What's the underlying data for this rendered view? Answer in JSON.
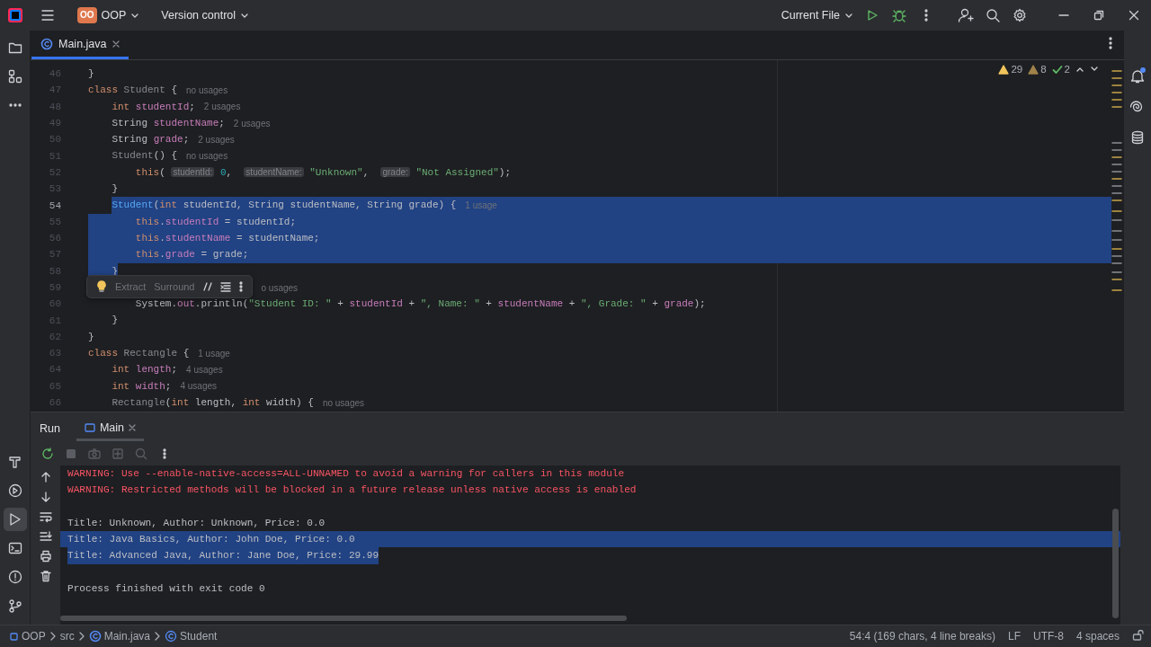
{
  "title_bar": {
    "project_badge": "OO",
    "project": "OOP",
    "vcs": "Version control",
    "run_config": "Current File"
  },
  "left_tools": [
    {
      "kind": "project",
      "selected": false
    },
    {
      "kind": "structure",
      "selected": false
    },
    {
      "kind": "more",
      "selected": false
    }
  ],
  "left_tools_bottom": [
    {
      "kind": "build",
      "selected": false
    },
    {
      "kind": "services",
      "selected": false
    },
    {
      "kind": "run",
      "selected": true
    },
    {
      "kind": "terminal",
      "selected": false
    },
    {
      "kind": "problems",
      "selected": false
    },
    {
      "kind": "git",
      "selected": false
    }
  ],
  "right_tools": [
    {
      "kind": "notifications",
      "unread": true
    },
    {
      "kind": "assistant",
      "unread": false
    },
    {
      "kind": "database",
      "unread": false
    }
  ],
  "editor_tabs": [
    {
      "label": "Main.java",
      "selected": true
    }
  ],
  "inspections": {
    "warnings": "29",
    "weak_warnings": "8",
    "typos": "2"
  },
  "lines": [
    {
      "number": "46",
      "current": false,
      "selected": false,
      "tokens": [
        {
          "t": "}",
          "kind": "plain"
        }
      ]
    },
    {
      "number": "47",
      "current": false,
      "selected": false,
      "tokens": [
        {
          "t": "class",
          "kind": "kw"
        },
        {
          "t": " Student",
          "kind": "unused"
        },
        {
          "t": " {",
          "kind": "plain"
        }
      ],
      "usage": "no usages"
    },
    {
      "number": "48",
      "current": false,
      "selected": false,
      "tokens": [
        {
          "t": "    int",
          "kind": "kw"
        },
        {
          "t": " studentId",
          "kind": "field"
        },
        {
          "t": ";",
          "kind": "plain"
        }
      ],
      "usage": "2 usages"
    },
    {
      "number": "49",
      "current": false,
      "selected": false,
      "tokens": [
        {
          "t": "    String ",
          "kind": "plain"
        },
        {
          "t": "studentName",
          "kind": "field"
        },
        {
          "t": ";",
          "kind": "plain"
        }
      ],
      "usage": "2 usages"
    },
    {
      "number": "50",
      "current": false,
      "selected": false,
      "tokens": [
        {
          "t": "    String ",
          "kind": "plain"
        },
        {
          "t": "grade",
          "kind": "field"
        },
        {
          "t": ";",
          "kind": "plain"
        }
      ],
      "usage": "2 usages"
    },
    {
      "number": "51",
      "current": false,
      "selected": false,
      "tokens": [
        {
          "t": "    Student",
          "kind": "unused"
        },
        {
          "t": "() {",
          "kind": "plain"
        }
      ],
      "usage": "no usages"
    },
    {
      "number": "52",
      "current": false,
      "selected": false,
      "tokens": [
        {
          "t": "        this",
          "kind": "kw"
        },
        {
          "t": "( ",
          "kind": "plain"
        },
        {
          "t": "studentId:",
          "kind": "inlay"
        },
        {
          "t": " 0",
          "kind": "num"
        },
        {
          "t": ",  ",
          "kind": "plain"
        },
        {
          "t": "studentName:",
          "kind": "inlay"
        },
        {
          "t": " \"Unknown\"",
          "kind": "str"
        },
        {
          "t": ",  ",
          "kind": "plain"
        },
        {
          "t": "grade:",
          "kind": "inlay"
        },
        {
          "t": " \"Not Assigned\"",
          "kind": "str"
        },
        {
          "t": ");",
          "kind": "plain"
        }
      ]
    },
    {
      "number": "53",
      "current": false,
      "selected": false,
      "tokens": [
        {
          "t": "    }",
          "kind": "plain"
        }
      ]
    },
    {
      "number": "54",
      "current": true,
      "selected": true,
      "tokens": [
        {
          "t": "    Student",
          "kind": "method"
        },
        {
          "t": "(",
          "kind": "plain"
        },
        {
          "t": "int",
          "kind": "kw"
        },
        {
          "t": " studentId, String studentName, String grade) {",
          "kind": "plain"
        }
      ],
      "usage": "1 usage"
    },
    {
      "number": "55",
      "current": false,
      "selected": true,
      "tokens": [
        {
          "t": "        this",
          "kind": "kw"
        },
        {
          "t": ".",
          "kind": "plain"
        },
        {
          "t": "studentId",
          "kind": "field"
        },
        {
          "t": " = studentId;",
          "kind": "plain"
        }
      ]
    },
    {
      "number": "56",
      "current": false,
      "selected": true,
      "tokens": [
        {
          "t": "        this",
          "kind": "kw"
        },
        {
          "t": ".",
          "kind": "plain"
        },
        {
          "t": "studentName",
          "kind": "field"
        },
        {
          "t": " = studentName;",
          "kind": "plain"
        }
      ]
    },
    {
      "number": "57",
      "current": false,
      "selected": true,
      "tokens": [
        {
          "t": "        this",
          "kind": "kw"
        },
        {
          "t": ".",
          "kind": "plain"
        },
        {
          "t": "grade",
          "kind": "field"
        },
        {
          "t": " = grade;",
          "kind": "plain"
        }
      ]
    },
    {
      "number": "58",
      "current": false,
      "selected": true,
      "tokens": [
        {
          "t": "    }",
          "kind": "plain"
        }
      ]
    },
    {
      "number": "59",
      "current": false,
      "selected": false,
      "tokens": [
        {
          "kind": "popup"
        }
      ],
      "usage": "o usages"
    },
    {
      "number": "60",
      "current": false,
      "selected": false,
      "tokens": [
        {
          "t": "        System.",
          "kind": "plain"
        },
        {
          "t": "out",
          "kind": "field"
        },
        {
          "t": ".println(",
          "kind": "plain"
        },
        {
          "t": "\"Student ID: \"",
          "kind": "str"
        },
        {
          "t": " + ",
          "kind": "plain"
        },
        {
          "t": "studentId",
          "kind": "field"
        },
        {
          "t": " + ",
          "kind": "plain"
        },
        {
          "t": "\", Name: \"",
          "kind": "str"
        },
        {
          "t": " + ",
          "kind": "plain"
        },
        {
          "t": "studentName",
          "kind": "field"
        },
        {
          "t": " + ",
          "kind": "plain"
        },
        {
          "t": "\", Grade: \"",
          "kind": "str"
        },
        {
          "t": " + ",
          "kind": "plain"
        },
        {
          "t": "grade",
          "kind": "field"
        },
        {
          "t": ");",
          "kind": "plain"
        }
      ]
    },
    {
      "number": "61",
      "current": false,
      "selected": false,
      "tokens": [
        {
          "t": "    }",
          "kind": "plain"
        }
      ]
    },
    {
      "number": "62",
      "current": false,
      "selected": false,
      "tokens": [
        {
          "t": "}",
          "kind": "plain"
        }
      ]
    },
    {
      "number": "63",
      "current": false,
      "selected": false,
      "tokens": [
        {
          "t": "class",
          "kind": "kw"
        },
        {
          "t": " Rectangle",
          "kind": "unused"
        },
        {
          "t": " {",
          "kind": "plain"
        }
      ],
      "usage": "1 usage"
    },
    {
      "number": "64",
      "current": false,
      "selected": false,
      "tokens": [
        {
          "t": "    int",
          "kind": "kw"
        },
        {
          "t": " length",
          "kind": "field"
        },
        {
          "t": ";",
          "kind": "plain"
        }
      ],
      "usage": "4 usages"
    },
    {
      "number": "65",
      "current": false,
      "selected": false,
      "tokens": [
        {
          "t": "    int",
          "kind": "kw"
        },
        {
          "t": " width",
          "kind": "field"
        },
        {
          "t": ";",
          "kind": "plain"
        }
      ],
      "usage": "4 usages"
    },
    {
      "number": "66",
      "current": false,
      "selected": false,
      "tokens": [
        {
          "t": "    Rectangle",
          "kind": "unused"
        },
        {
          "t": "(",
          "kind": "plain"
        },
        {
          "t": "int",
          "kind": "kw"
        },
        {
          "t": " length, ",
          "kind": "plain"
        },
        {
          "t": "int",
          "kind": "kw"
        },
        {
          "t": " width) {",
          "kind": "plain"
        }
      ],
      "usage": "no usages"
    }
  ],
  "popup": {
    "actions": [
      "Extract",
      "Surround"
    ]
  },
  "run_panel": {
    "title": "Run",
    "tabs": [
      {
        "label": "Main",
        "selected": true
      }
    ],
    "console": [
      {
        "kind": "warning",
        "selected": false,
        "text": "WARNING: Use --enable-native-access=ALL-UNNAMED to avoid a warning for callers in this module"
      },
      {
        "kind": "warning",
        "selected": false,
        "text": "WARNING: Restricted methods will be blocked in a future release unless native access is enabled"
      },
      {
        "kind": "blank",
        "selected": false
      },
      {
        "kind": "output",
        "selected": false,
        "text": "Title: Unknown, Author: Unknown, Price: 0.0"
      },
      {
        "kind": "output",
        "selected": true,
        "text": "Title: Java Basics, Author: John Doe, Price: 0.0"
      },
      {
        "kind": "output",
        "selected": true,
        "text": "Title: Advanced Java, Author: Jane Doe, Price: 29.99"
      },
      {
        "kind": "blank",
        "selected": false
      },
      {
        "kind": "output",
        "selected": false,
        "text": "Process finished with exit code 0"
      }
    ]
  },
  "status_bar": {
    "breadcrumbs": [
      {
        "label": "OOP",
        "kind": "module"
      },
      {
        "label": "src",
        "kind": "folder"
      },
      {
        "label": "Main.java",
        "kind": "file"
      },
      {
        "label": "Student",
        "kind": "class"
      }
    ],
    "position": "54:4 (169 chars, 4 line breaks)",
    "line_separator": "LF",
    "encoding": "UTF-8",
    "indent": "4 spaces"
  }
}
